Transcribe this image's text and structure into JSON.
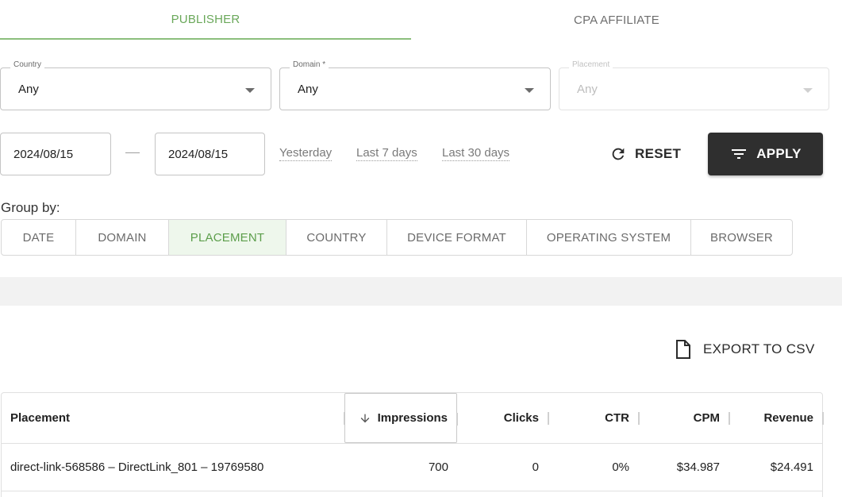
{
  "tabs": [
    {
      "label": "PUBLISHER",
      "active": true
    },
    {
      "label": "CPA AFFILIATE",
      "active": false
    }
  ],
  "filters": {
    "country": {
      "label": "Country",
      "value": "Any"
    },
    "domain": {
      "label": "Domain *",
      "value": "Any"
    },
    "placement": {
      "label": "Placement",
      "value": "Any",
      "disabled": true
    }
  },
  "dates": {
    "from": "2024/08/15",
    "to": "2024/08/15"
  },
  "quick_ranges": [
    "Yesterday",
    "Last 7 days",
    "Last 30 days"
  ],
  "actions": {
    "reset_label": "RESET",
    "apply_label": "APPLY",
    "export_label": "EXPORT TO CSV"
  },
  "group_by": {
    "label": "Group by:",
    "options": [
      "DATE",
      "DOMAIN",
      "PLACEMENT",
      "COUNTRY",
      "DEVICE FORMAT",
      "OPERATING SYSTEM",
      "BROWSER"
    ],
    "active": "PLACEMENT"
  },
  "table": {
    "columns": [
      "Placement",
      "Impressions",
      "Clicks",
      "CTR",
      "CPM",
      "Revenue"
    ],
    "sorted_column": "Impressions",
    "sort_direction": "desc",
    "rows": [
      [
        "direct-link-568586 – DirectLink_801 – 19769580",
        "700",
        "0",
        "0%",
        "$34.987",
        "$24.491"
      ]
    ]
  },
  "colors": {
    "accent": "#6aa85a",
    "apply_bg": "#2f2f2f",
    "band": "#f2f2f2"
  }
}
